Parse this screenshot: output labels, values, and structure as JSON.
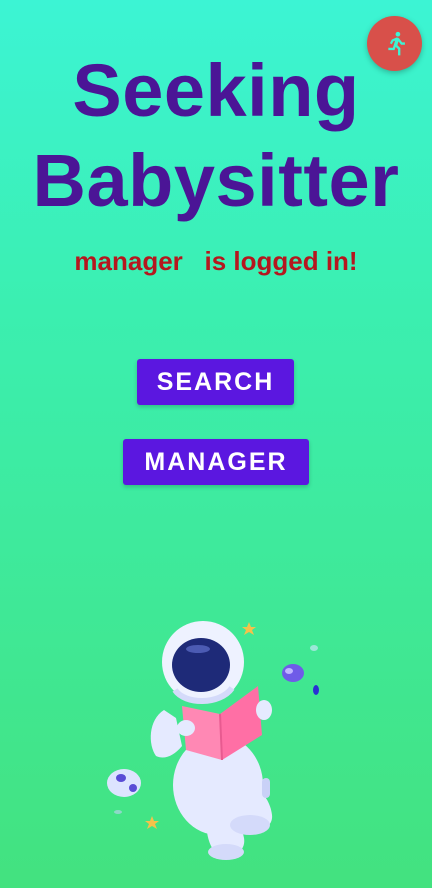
{
  "header": {
    "title_line1": "Seeking",
    "title_line2": "Babysitter",
    "logout_icon": "running-person-icon"
  },
  "status": {
    "username": "manager",
    "suffix": "is logged in!",
    "message": "manager   is logged in!"
  },
  "actions": {
    "search_label": "SEARCH",
    "manager_label": "MANAGER"
  },
  "illustration": {
    "icon": "astronaut-reading-book-icon"
  },
  "colors": {
    "title": "#4B1596",
    "status": "#B5171E",
    "button": "#5B17E0",
    "fab": "#D8504A",
    "fab_icon": "#3CF4D4",
    "gradient_top": "#3CF4D4",
    "gradient_bottom": "#43E27F"
  }
}
